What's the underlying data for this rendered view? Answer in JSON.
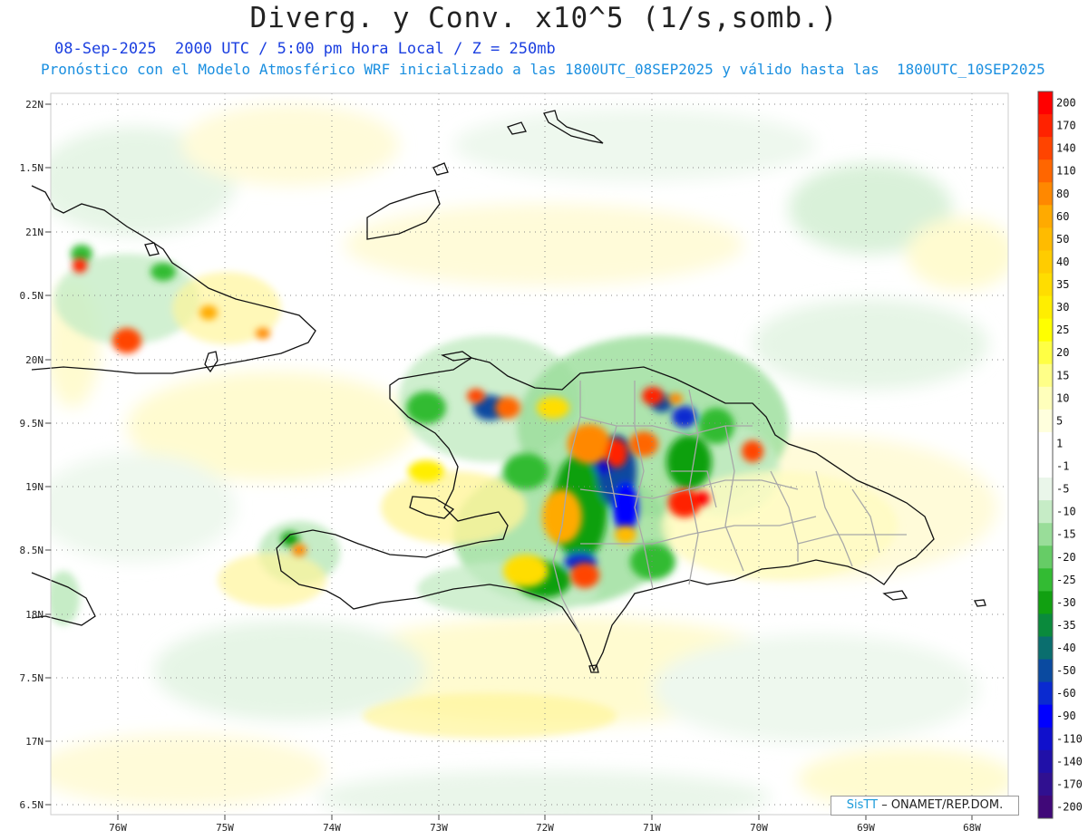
{
  "header": {
    "title": "Diverg. y Conv. x10^5 (1/s,somb.)",
    "subtitle1": "08-Sep-2025  2000 UTC / 5:00 pm Hora Local / Z = 250mb",
    "subtitle2": "Pronóstico con el Modelo Atmosférico WRF inicializado a las 1800UTC_08SEP2025 y válido hasta las  1800UTC_10SEP2025"
  },
  "axes": {
    "lat_labels": [
      "22N",
      "1.5N",
      "21N",
      "0.5N",
      "20N",
      "9.5N",
      "19N",
      "8.5N",
      "18N",
      "7.5N",
      "17N",
      "6.5N"
    ],
    "lon_labels": [
      "76W",
      "75W",
      "74W",
      "73W",
      "72W",
      "71W",
      "70W",
      "69W",
      "68W"
    ]
  },
  "colorbar": {
    "levels": [
      "200",
      "170",
      "140",
      "110",
      "80",
      "60",
      "50",
      "40",
      "35",
      "30",
      "25",
      "20",
      "15",
      "10",
      "5",
      "1",
      "-1",
      "-5",
      "-10",
      "-15",
      "-20",
      "-25",
      "-30",
      "-35",
      "-40",
      "-50",
      "-60",
      "-90",
      "-110",
      "-140",
      "-170",
      "-200"
    ],
    "colors": [
      "#ff0000",
      "#ff2200",
      "#ff4400",
      "#ff6600",
      "#ff8800",
      "#ffaa00",
      "#ffbb00",
      "#ffcc00",
      "#ffdd00",
      "#ffee00",
      "#ffff00",
      "#ffff44",
      "#ffff88",
      "#ffffbb",
      "#ffffdd",
      "#ffffff",
      "#ffffff",
      "#eaf6ea",
      "#c6ecc6",
      "#99dd99",
      "#66cc66",
      "#33bb33",
      "#11a011",
      "#0a8a3c",
      "#0a6e6e",
      "#0a4aa0",
      "#0a2ad0",
      "#0000ff",
      "#1010cc",
      "#2010a8",
      "#301090",
      "#400878"
    ]
  },
  "credit": {
    "brand": "SisTT",
    "text": " – ONAMET/REP.DOM."
  }
}
